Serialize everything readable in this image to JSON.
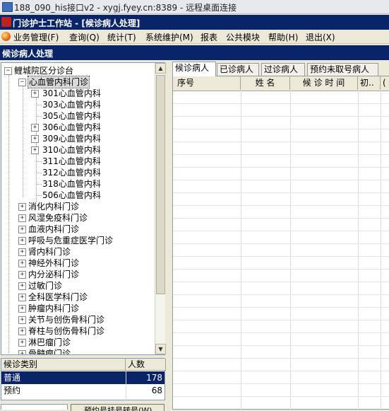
{
  "rdp_title": "188_090_his接口v2 - xygj.fyey.cn:8389 - 远程桌面连接",
  "app_title": "门诊护士工作站 - [候诊病人处理]",
  "menu": [
    "业务管理(F)",
    "查询(Q)",
    "统计(T)",
    "系统维护(M)",
    "报表",
    "公共模块",
    "帮助(H)",
    "退出(X)"
  ],
  "banner": "候诊病人处理",
  "tree": {
    "root": "鲤城院区分诊台",
    "selected_branch": "心血管内科门诊",
    "clinics": [
      {
        "label": "301心血管内科",
        "expandable": true
      },
      {
        "label": "303心血管内科",
        "expandable": false
      },
      {
        "label": "305心血管内科",
        "expandable": false
      },
      {
        "label": "306心血管内科",
        "expandable": true
      },
      {
        "label": "309心血管内科",
        "expandable": true
      },
      {
        "label": "310心血管内科",
        "expandable": true
      },
      {
        "label": "311心血管内科",
        "expandable": false
      },
      {
        "label": "312心血管内科",
        "expandable": false
      },
      {
        "label": "318心血管内科",
        "expandable": false
      },
      {
        "label": "506心血管内科",
        "expandable": false
      }
    ],
    "departments": [
      "消化内科门诊",
      "风湿免疫科门诊",
      "血液内科门诊",
      "呼吸与危重症医学门诊",
      "肾内科门诊",
      "神经外科门诊",
      "内分泌科门诊",
      "过敏门诊",
      "全科医学科门诊",
      "肿瘤内科门诊",
      "关节与创伤骨科门诊",
      "脊柱与创伤骨科门诊",
      "淋巴瘤门诊",
      "骨髓瘤门诊"
    ]
  },
  "category_grid": {
    "headers": [
      "候诊类别",
      "人数"
    ],
    "rows": [
      {
        "type": "普通",
        "count": "178"
      },
      {
        "type": "预约",
        "count": "68"
      }
    ]
  },
  "bottom_button": "预约号挂号转号(W)",
  "tabs": [
    "候诊病人",
    "已诊病人",
    "过诊病人",
    "预约未取号病人"
  ],
  "active_tab": 0,
  "list_headers": [
    "序号",
    "姓 名",
    "候 诊 时 间",
    "初..",
    "("
  ],
  "colors": {
    "title_bg": "#0a246a",
    "window_bg": "#ece9d8",
    "highlight": "#0a246a"
  }
}
